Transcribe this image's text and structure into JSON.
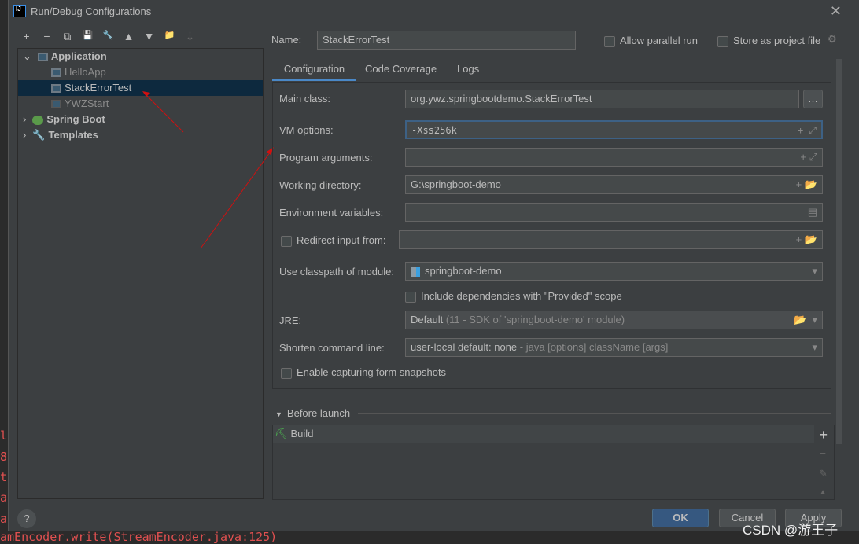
{
  "window": {
    "title": "Run/Debug Configurations",
    "logo": "IJ"
  },
  "toolbar": [
    "+",
    "−",
    "⧉",
    "💾",
    "🔧",
    "▲",
    "▼",
    "📁",
    "⇣"
  ],
  "tree": {
    "application": "Application",
    "items": [
      "HelloApp",
      "StackErrorTest",
      "YWZStart"
    ],
    "spring_boot": "Spring Boot",
    "templates": "Templates"
  },
  "name": {
    "label": "Name:",
    "value": "StackErrorTest"
  },
  "allow_parallel": "Allow parallel run",
  "store_project": "Store as project file",
  "tabs": [
    "Configuration",
    "Code Coverage",
    "Logs"
  ],
  "form": {
    "main_class_label": "Main class:",
    "main_class": "org.ywz.springbootdemo.StackErrorTest",
    "vm_label": "VM options:",
    "vm": "-Xss256k",
    "args_label": "Program arguments:",
    "wd_label": "Working directory:",
    "wd": "G:\\springboot-demo",
    "env_label": "Environment variables:",
    "redirect_label": "Redirect input from:",
    "module_label": "Use classpath of module:",
    "module": "springboot-demo",
    "include_deps": "Include dependencies with \"Provided\" scope",
    "jre_label": "JRE:",
    "jre": "Default",
    "jre_hint": "(11 - SDK of 'springboot-demo' module)",
    "shorten_label": "Shorten command line:",
    "shorten": "user-local default: none",
    "shorten_hint": "- java [options] className [args]",
    "snapshots": "Enable capturing form snapshots"
  },
  "before_launch": {
    "title": "Before launch",
    "items": [
      "Build"
    ]
  },
  "buttons": {
    "ok": "OK",
    "cancel": "Cancel",
    "apply": "Apply",
    "help": "?"
  },
  "watermark": "CSDN @游王子",
  "bg_code": [
    "l",
    "8",
    "t",
    "a",
    "a",
    "amEncoder.write(StreamEncoder.java:125)"
  ]
}
